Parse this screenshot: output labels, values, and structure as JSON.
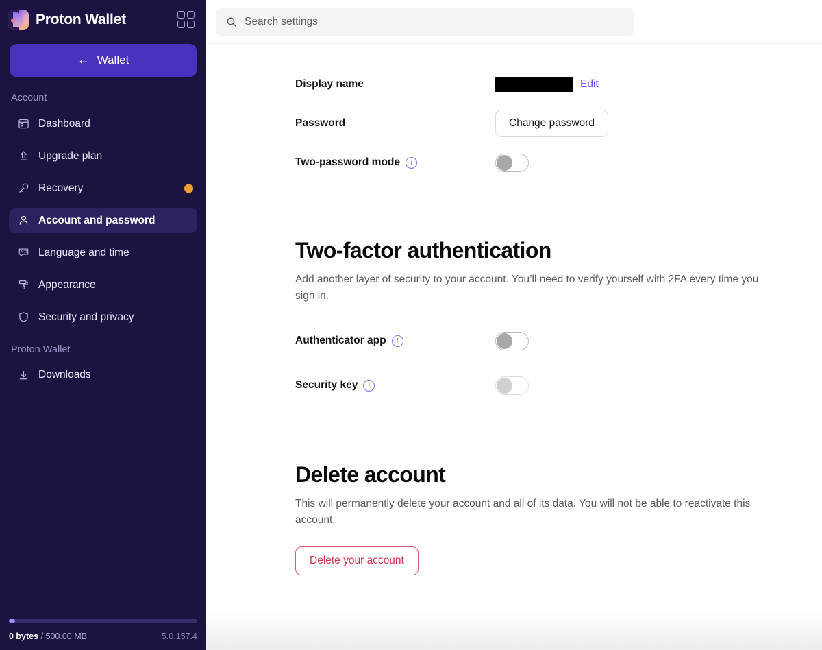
{
  "sidebar": {
    "brand": {
      "name": "Proton Wallet",
      "logo_icon": "proton-wallet-logo",
      "apps_icon": "app-grid-icon"
    },
    "wallet_button": {
      "label": "Wallet",
      "arrow_glyph": "←"
    },
    "sections": [
      {
        "heading": "Account",
        "items": [
          {
            "label": "Dashboard",
            "icon": "dashboard-icon",
            "active": false,
            "badge": false
          },
          {
            "label": "Upgrade plan",
            "icon": "upgrade-arrow-icon",
            "active": false,
            "badge": false
          },
          {
            "label": "Recovery",
            "icon": "key-icon",
            "active": false,
            "badge": true
          },
          {
            "label": "Account and password",
            "icon": "user-icon",
            "active": true,
            "badge": false
          },
          {
            "label": "Language and time",
            "icon": "language-icon",
            "active": false,
            "badge": false
          },
          {
            "label": "Appearance",
            "icon": "paint-roller-icon",
            "active": false,
            "badge": false
          },
          {
            "label": "Security and privacy",
            "icon": "shield-icon",
            "active": false,
            "badge": false
          }
        ]
      },
      {
        "heading": "Proton Wallet",
        "items": [
          {
            "label": "Downloads",
            "icon": "download-icon",
            "active": false,
            "badge": false
          }
        ]
      }
    ],
    "storage": {
      "used": "0 bytes",
      "separator": " / ",
      "total": "500.00 MB",
      "version": "5.0.157.4",
      "percent": 1
    },
    "colors": {
      "background": "#1c1340",
      "active_item": "#2e2160",
      "wallet_button": "#4b31bd",
      "badge": "#f0a030"
    }
  },
  "topbar": {
    "search": {
      "placeholder": "Search settings",
      "value": "",
      "icon": "search-icon"
    }
  },
  "main": {
    "account_rows": [
      {
        "label": "Display name",
        "value_redacted": true,
        "action_label": "Edit",
        "info": false
      },
      {
        "label": "Password",
        "action_label": "Change password",
        "info": false
      },
      {
        "label": "Two-password mode",
        "info": true,
        "info_icon": "info-icon",
        "toggle": {
          "state": "off",
          "disabled": false
        }
      }
    ],
    "two_factor": {
      "title": "Two-factor authentication",
      "description": "Add another layer of security to your account. You’ll need to verify yourself with 2FA every time you sign in.",
      "rows": [
        {
          "label": "Authenticator app",
          "info": true,
          "info_icon": "info-icon",
          "toggle": {
            "state": "off",
            "disabled": false
          }
        },
        {
          "label": "Security key",
          "info": true,
          "info_icon": "info-icon",
          "toggle": {
            "state": "off",
            "disabled": true
          }
        }
      ]
    },
    "delete_account": {
      "title": "Delete account",
      "description": "This will permanently delete your account and all of its data. You will not be able to reactivate this account.",
      "button_label": "Delete your account",
      "button_color": "#d9334e"
    }
  }
}
